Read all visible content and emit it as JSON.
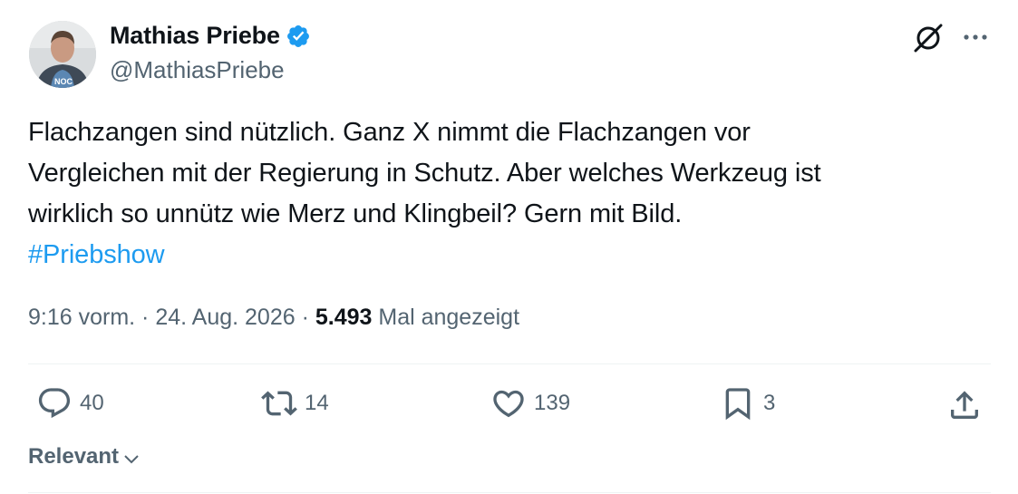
{
  "author": {
    "name": "Mathias Priebe",
    "handle": "@MathiasPriebe",
    "verified_color": "#1d9bf0"
  },
  "icons": {
    "top_right": [
      "grok-icon",
      "more-icon"
    ],
    "actions": [
      "reply-icon",
      "retweet-icon",
      "like-icon",
      "bookmark-icon",
      "share-icon"
    ]
  },
  "tweet": {
    "lines": [
      "Flachzangen sind nützlich. Ganz X nimmt die Flachzangen vor",
      "Vergleichen mit der Regierung in Schutz. Aber welches Werkzeug ist",
      "wirklich so unnütz wie Merz und Klingbeil? Gern mit Bild."
    ],
    "hashtag": "#Priebshow",
    "hashtag_color": "#1d9bf0"
  },
  "meta": {
    "time": "9:16 vorm.",
    "sep1": " · ",
    "date": "24. Aug. 2026",
    "sep2": " · ",
    "views": "5.493",
    "views_label": " Mal angezeigt"
  },
  "actions": {
    "replies": "40",
    "retweets": "14",
    "likes": "139",
    "bookmarks": "3"
  },
  "sort": {
    "label": "Relevant"
  }
}
